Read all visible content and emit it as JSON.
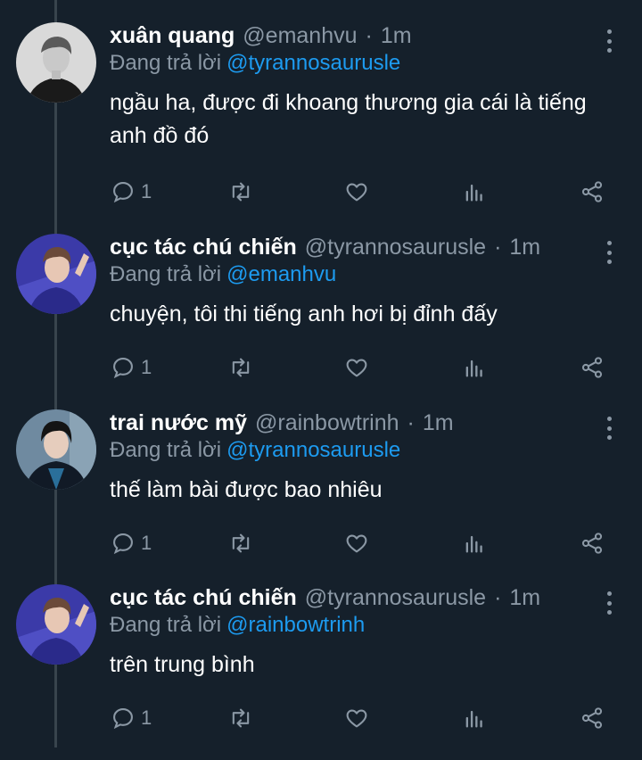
{
  "tweets": [
    {
      "name": "xuân quang",
      "handle": "@emanhvu",
      "time": "1m",
      "reply_prefix": "Đang trả lời",
      "reply_to": "@tyrannosaurusle",
      "text": "ngầu ha, được đi khoang thương gia cái là tiếng anh đồ đó",
      "reply_count": "1"
    },
    {
      "name": "cục tác chú chiến",
      "handle": "@tyrannosaurusle",
      "time": "1m",
      "reply_prefix": "Đang trả lời",
      "reply_to": "@emanhvu",
      "text": "chuyện, tôi thi tiếng anh hơi bị đỉnh đấy",
      "reply_count": "1"
    },
    {
      "name": "trai nước mỹ",
      "handle": "@rainbowtrinh",
      "time": "1m",
      "reply_prefix": "Đang trả lời",
      "reply_to": "@tyrannosaurusle",
      "text": "thế làm bài được bao nhiêu",
      "reply_count": "1"
    },
    {
      "name": "cục tác chú chiến",
      "handle": "@tyrannosaurusle",
      "time": "1m",
      "reply_prefix": "Đang trả lời",
      "reply_to": "@rainbowtrinh",
      "text": "trên trung bình",
      "reply_count": "1"
    }
  ],
  "separator": "·",
  "icons": {
    "reply": "reply-icon",
    "retweet": "retweet-icon",
    "like": "heart-icon",
    "analytics": "analytics-icon",
    "share": "share-icon",
    "more": "more-icon"
  },
  "colors": {
    "background": "#15202b",
    "muted": "#8b98a5",
    "mention": "#1d9bf0",
    "thread_line": "#38444d"
  }
}
